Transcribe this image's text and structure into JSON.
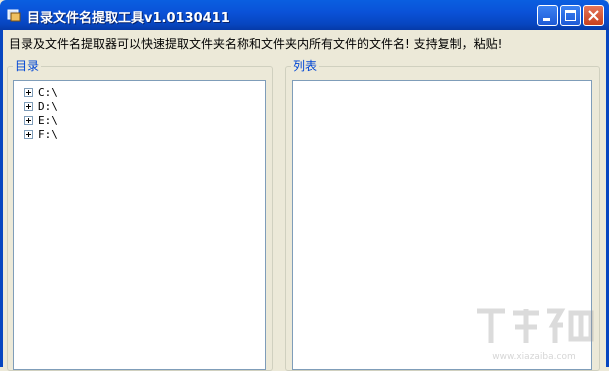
{
  "window": {
    "title": "目录文件名提取工具v1.0130411"
  },
  "description": "目录及文件名提取器可以快速提取文件夹名称和文件夹内所有文件的文件名! 支持复制，粘贴!",
  "directory_panel": {
    "label": "目录",
    "items": [
      {
        "label": "C:\\"
      },
      {
        "label": "D:\\"
      },
      {
        "label": "E:\\"
      },
      {
        "label": "F:\\"
      }
    ]
  },
  "list_panel": {
    "label": "列表"
  },
  "watermark": {
    "text": "www.xiazaiba.com"
  },
  "colors": {
    "titlebar": "#0A52D8",
    "window_bg": "#ECE9D8",
    "group_label": "#0046D5"
  }
}
